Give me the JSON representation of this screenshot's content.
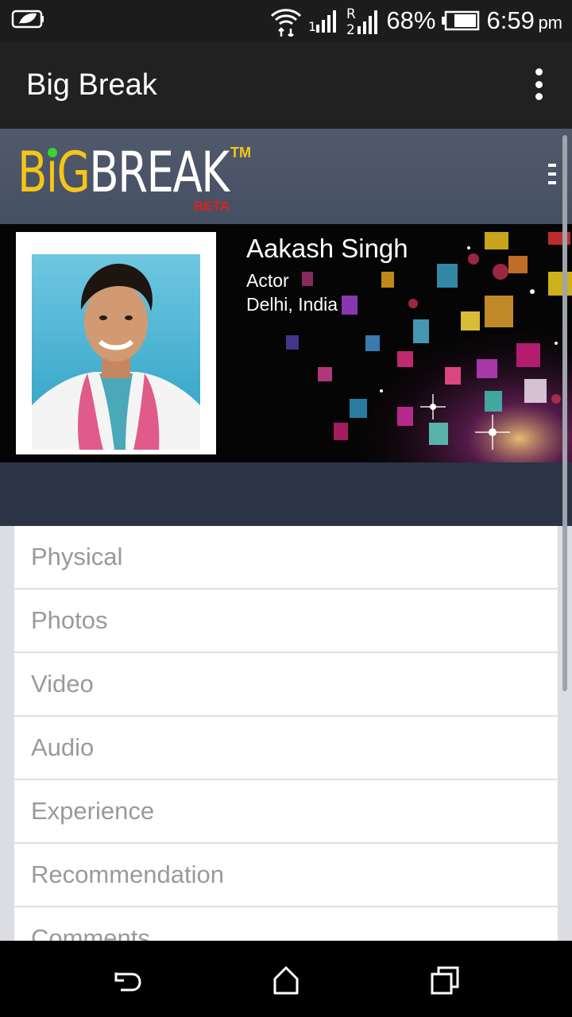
{
  "status_bar": {
    "battery": "68%",
    "time": "6:59",
    "time_suffix": "pm",
    "icons": [
      "leaf-icon",
      "wifi-icon",
      "signal-icon",
      "roaming-signal-icon",
      "battery-icon"
    ]
  },
  "app_bar": {
    "title": "Big Break",
    "overflow_icon": "more-vert-icon"
  },
  "site": {
    "logo": {
      "big": "BiG",
      "break": "BREAK",
      "tm": "TM",
      "beta": "BETA"
    },
    "menu_icon": "hamburger-icon"
  },
  "profile": {
    "name": "Aakash Singh",
    "role": "Actor",
    "location": "Delhi, India"
  },
  "menu": {
    "items": [
      {
        "label": "Physical"
      },
      {
        "label": "Photos"
      },
      {
        "label": "Video"
      },
      {
        "label": "Audio"
      },
      {
        "label": "Experience"
      },
      {
        "label": "Recommendation"
      },
      {
        "label": "Comments"
      }
    ]
  },
  "nav_bar": {
    "icons": [
      "back-icon",
      "home-icon",
      "recents-icon"
    ]
  },
  "colors": {
    "logo_yellow": "#f5c518",
    "logo_beta_red": "#e02020",
    "header_bg": "#4a5568",
    "strip_bg": "#2b3444",
    "menu_text": "#9a9a9a"
  }
}
